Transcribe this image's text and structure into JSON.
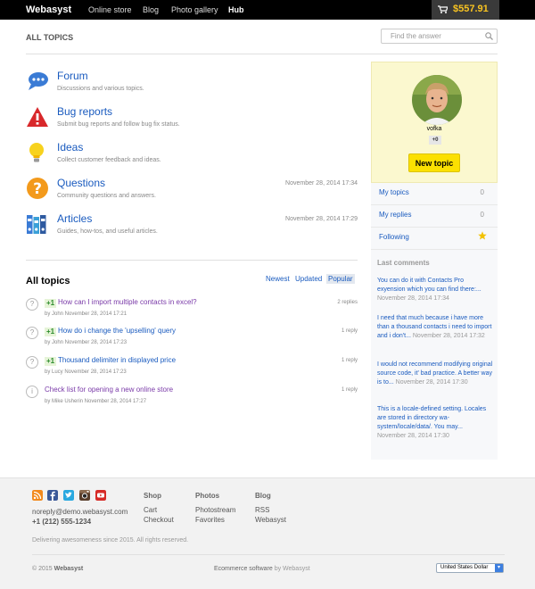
{
  "topbar": {
    "brand": "Webasyst",
    "nav": [
      "Online store",
      "Blog",
      "Photo gallery",
      "Hub"
    ],
    "cart_total": "$557.91"
  },
  "header": {
    "title": "ALL TOPICS",
    "search_placeholder": "Find the answer"
  },
  "categories": [
    {
      "name": "Forum",
      "description": "Discussions and various topics.",
      "date": "",
      "icon": "chat-bubble-icon"
    },
    {
      "name": "Bug reports",
      "description": "Submit bug reports and follow bug fix status.",
      "date": "",
      "icon": "warning-icon"
    },
    {
      "name": "Ideas",
      "description": "Collect customer feedback and ideas.",
      "date": "",
      "icon": "lightbulb-icon"
    },
    {
      "name": "Questions",
      "description": "Community questions and answers.",
      "date": "November 28, 2014 17:34",
      "icon": "question-icon"
    },
    {
      "name": "Articles",
      "description": "Guides, how-tos, and useful articles.",
      "date": "November 28, 2014 17:29",
      "icon": "binders-icon"
    }
  ],
  "topics_section": {
    "heading": "All topics",
    "sort": [
      "Newest",
      "Updated",
      "Popular"
    ],
    "active_sort": "Popular"
  },
  "topics": [
    {
      "vote": "+1",
      "title": "How can I import multiple contacts in excel?",
      "meta": "by John November 28, 2014 17:21",
      "replies": "2 replies",
      "icon": "?"
    },
    {
      "vote": "+1",
      "title": "How do i change the 'upselling' query",
      "meta": "by John November 28, 2014 17:23",
      "replies": "1 reply",
      "icon": "?"
    },
    {
      "vote": "+1",
      "title": "Thousand delimiter in displayed price",
      "meta": "by Lucy November 28, 2014 17:23",
      "replies": "1 reply",
      "icon": "?"
    },
    {
      "vote": "",
      "title": "Check list for opening a new online store",
      "meta": "by Mike Usherin November 28, 2014 17:27",
      "replies": "1 reply",
      "icon": "i"
    }
  ],
  "profile": {
    "username": "vofka",
    "rating": "+0",
    "new_topic_label": "New topic"
  },
  "sidebar_links": [
    {
      "label": "My topics",
      "count": "0"
    },
    {
      "label": "My replies",
      "count": "0"
    },
    {
      "label": "Following",
      "count": ""
    }
  ],
  "comments": {
    "heading": "Last comments",
    "items": [
      {
        "text": "You can do it with Contacts Pro exyension which you can find there:...",
        "date": " November 28, 2014 17:34",
        "lines": [
          "You can do it with Contacts Pro exyen",
          "sion which you can find there:...",
          " Nove",
          "mber 28, 2014 17:34"
        ]
      },
      {
        "text": "I need that much because i have more than a thousand contacts i need to import and i don't...",
        "date": "November 28, 2014 17:32"
      },
      {
        "text": "I would not recommend modifying original source code, it' bad practice. A better way is to...",
        "date": "November 28, 2014 17:30"
      },
      {
        "text": "This is a locale-defined setting. Locales are stored in directory wa-system/locale/data/. You may...",
        "date": "November 28, 2014 17:30"
      }
    ]
  },
  "footer": {
    "email": "noreply@demo.webasyst.com",
    "phone": "+1 (212) 555-1234",
    "columns": [
      {
        "heading": "Shop",
        "links": [
          "Cart",
          "Checkout"
        ]
      },
      {
        "heading": "Photos",
        "links": [
          "Photostream",
          "Favorites"
        ]
      },
      {
        "heading": "Blog",
        "links": [
          "RSS",
          "Webasyst"
        ]
      }
    ],
    "tagline": "Delivering awesomeness since 2015. All rights reserved.",
    "copyright_prefix": "© 2015",
    "copyright_brand": "Webasyst",
    "ecommerce_text": "Ecommerce software",
    "ecommerce_by": "by Webasyst",
    "currency": "United States Dollar",
    "social_icons": [
      "rss-icon",
      "facebook-icon",
      "twitter-icon",
      "instagram-icon",
      "youtube-icon"
    ]
  },
  "colors": {
    "accent_link": "#1a5bbf",
    "cart_total": "#f8c321",
    "new_topic_button": "#fbe001",
    "profile_bg": "#fbf8cf"
  }
}
